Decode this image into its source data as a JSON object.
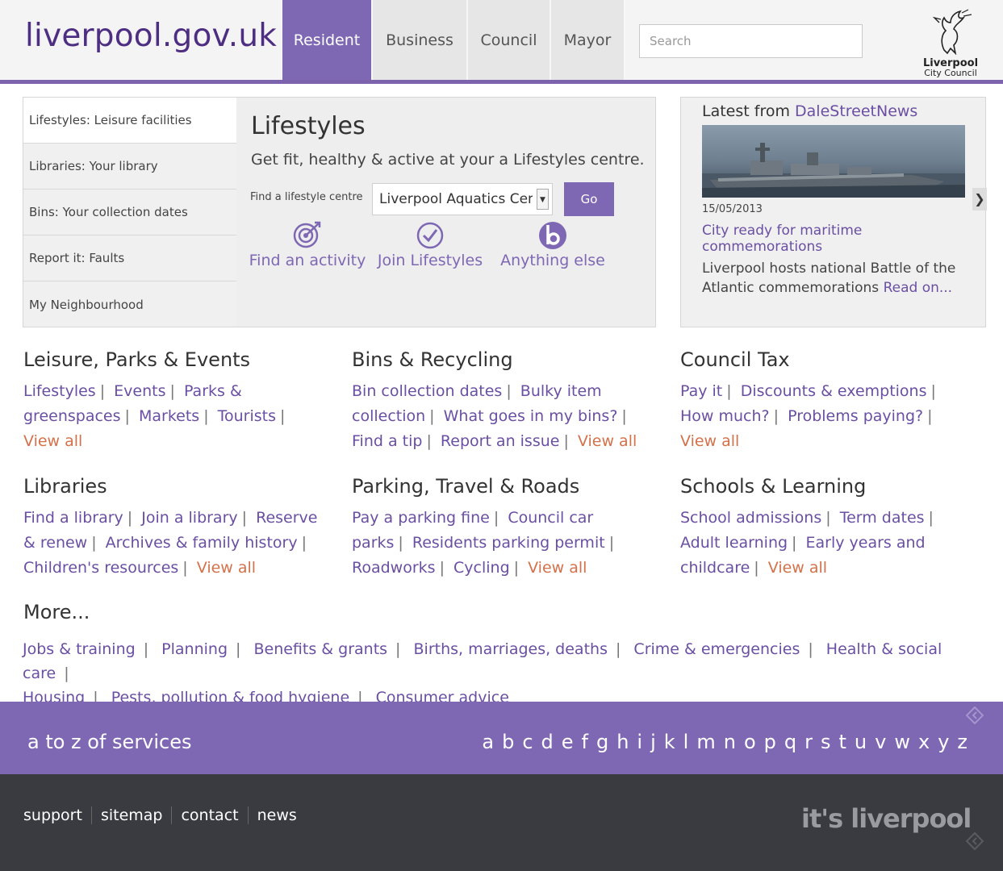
{
  "header": {
    "logo": "liverpool.gov.uk",
    "nav": [
      {
        "label": "Resident",
        "active": true
      },
      {
        "label": "Business",
        "active": false
      },
      {
        "label": "Council",
        "active": false
      },
      {
        "label": "Mayor",
        "active": false
      }
    ],
    "search_placeholder": "Search",
    "crest": {
      "line1": "Liverpool",
      "line2": "City Council"
    }
  },
  "quick_links": [
    "Lifestyles: Leisure facilities",
    "Libraries: Your library",
    "Bins: Your collection dates",
    "Report it: Faults",
    "My Neighbourhood"
  ],
  "feature": {
    "title": "Lifestyles",
    "subtitle": "Get fit, healthy & active at your a Lifestyles centre.",
    "find_label": "Find a lifestyle centre",
    "select_value": "Liverpool Aquatics Centre",
    "go_label": "Go",
    "actions": [
      {
        "label": "Find an activity",
        "icon": "target-icon"
      },
      {
        "label": "Join Lifestyles",
        "icon": "check-circle-icon"
      },
      {
        "label": "Anything else",
        "icon": "b-circle-icon"
      }
    ]
  },
  "news": {
    "heading": "Latest from ",
    "heading_link": "DaleStreetNews",
    "date": "15/05/2013",
    "title": "City ready for maritime commemorations",
    "body": "Liverpool hosts national Battle of the Atlantic commemorations ",
    "read_more": "Read on...",
    "next_glyph": "❯"
  },
  "categories": [
    {
      "title": "Leisure, Parks & Events",
      "links": [
        "Lifestyles",
        "Events",
        "Parks & greenspaces",
        "Markets",
        "Tourists"
      ],
      "view_all": "View all"
    },
    {
      "title": "Bins & Recycling",
      "links": [
        "Bin collection dates",
        "Bulky item collection",
        "What goes in my bins?",
        "Find a tip",
        "Report an issue"
      ],
      "view_all": "View all"
    },
    {
      "title": "Council Tax",
      "links": [
        "Pay it",
        "Discounts & exemptions",
        "How much?",
        "Problems paying?"
      ],
      "view_all": "View all"
    },
    {
      "title": "Libraries",
      "links": [
        "Find a library",
        "Join a library",
        "Reserve & renew",
        "Archives & family history",
        "Children's resources"
      ],
      "view_all": "View all"
    },
    {
      "title": "Parking, Travel & Roads",
      "links": [
        "Pay a parking fine",
        "Council car parks",
        "Residents parking permit",
        "Roadworks",
        "Cycling"
      ],
      "view_all": "View all"
    },
    {
      "title": "Schools & Learning",
      "links": [
        "School admissions",
        "Term dates",
        "Adult learning",
        "Early years and childcare"
      ],
      "view_all": "View all"
    }
  ],
  "more": {
    "title": "More...",
    "links": [
      "Jobs & training",
      "Planning",
      "Benefits & grants",
      "Births, marriages, deaths",
      "Crime & emergencies",
      "Health & social care",
      "Housing",
      "Pests, pollution & food hygiene",
      "Consumer advice"
    ]
  },
  "atoz": {
    "title": "a to z of services",
    "letters": [
      "a",
      "b",
      "c",
      "d",
      "e",
      "f",
      "g",
      "h",
      "i",
      "j",
      "k",
      "l",
      "m",
      "n",
      "o",
      "p",
      "q",
      "r",
      "s",
      "t",
      "u",
      "v",
      "w",
      "x",
      "y",
      "z"
    ]
  },
  "footer": {
    "links": [
      "support",
      "sitemap",
      "contact",
      "news"
    ],
    "tagline": "it's liverpool"
  },
  "colors": {
    "brand_purple": "#7e67b3",
    "link_purple": "#6a4fa3",
    "view_all_orange": "#d5714a",
    "footer_dark": "#3a3b41"
  }
}
